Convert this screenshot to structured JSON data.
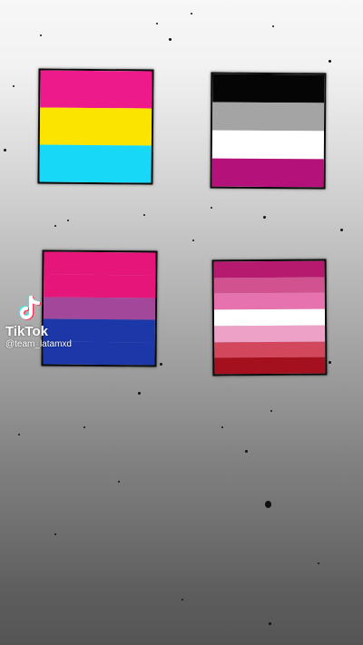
{
  "flags": [
    {
      "name": "pansexual-flag",
      "stripes": [
        "#ec1a8a",
        "#fbe500",
        "#17d8f7"
      ]
    },
    {
      "name": "asexual-flag",
      "stripes": [
        "#050505",
        "#a4a4a4",
        "#ffffff",
        "#b5117a"
      ]
    },
    {
      "name": "bisexual-flag",
      "stripes": [
        "#e6157a",
        "#e6157a",
        "#a3479b",
        "#1b37a8",
        "#1b37a8"
      ]
    },
    {
      "name": "lesbian-flag",
      "stripes": [
        "#b51a6e",
        "#d0538f",
        "#e672b0",
        "#ffffff",
        "#eea1c6",
        "#d3475c",
        "#a4101e"
      ]
    }
  ],
  "watermark": {
    "brand": "TikTok",
    "username": "@team_latamxd",
    "icon": "tiktok-logo-icon"
  }
}
